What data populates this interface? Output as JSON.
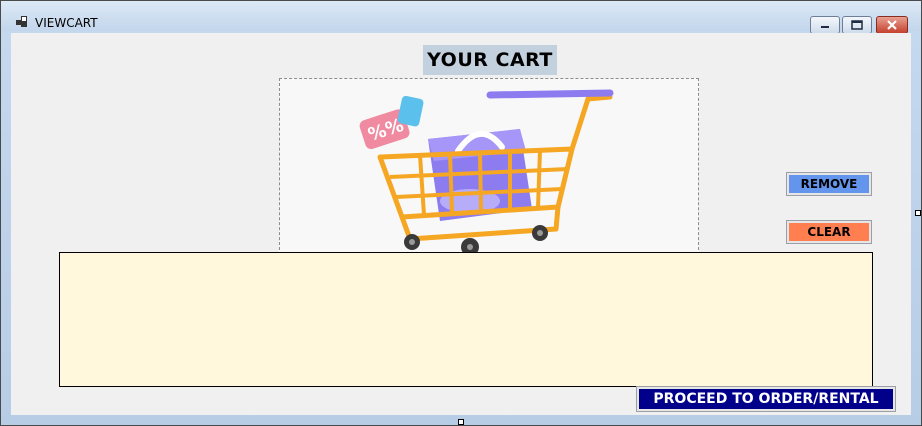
{
  "window": {
    "title": "VIEWCART",
    "icons": {
      "app": "app-icon",
      "minimize": "minimize-icon",
      "maximize": "maximize-icon",
      "close": "close-icon"
    }
  },
  "main": {
    "heading": "YOUR CART",
    "image": {
      "description": "shopping-cart-illustration"
    },
    "buttons": {
      "remove": "REMOVE",
      "clear": "CLEAR",
      "proceed": "PROCEED TO ORDER/RENTAL"
    },
    "grid": {
      "rows": []
    }
  },
  "colors": {
    "remove_button": "#6495ed",
    "clear_button": "#ff7f50",
    "proceed_button": "#00008b",
    "grid_background": "#fff8dc",
    "heading_background": "#c3d0de"
  }
}
